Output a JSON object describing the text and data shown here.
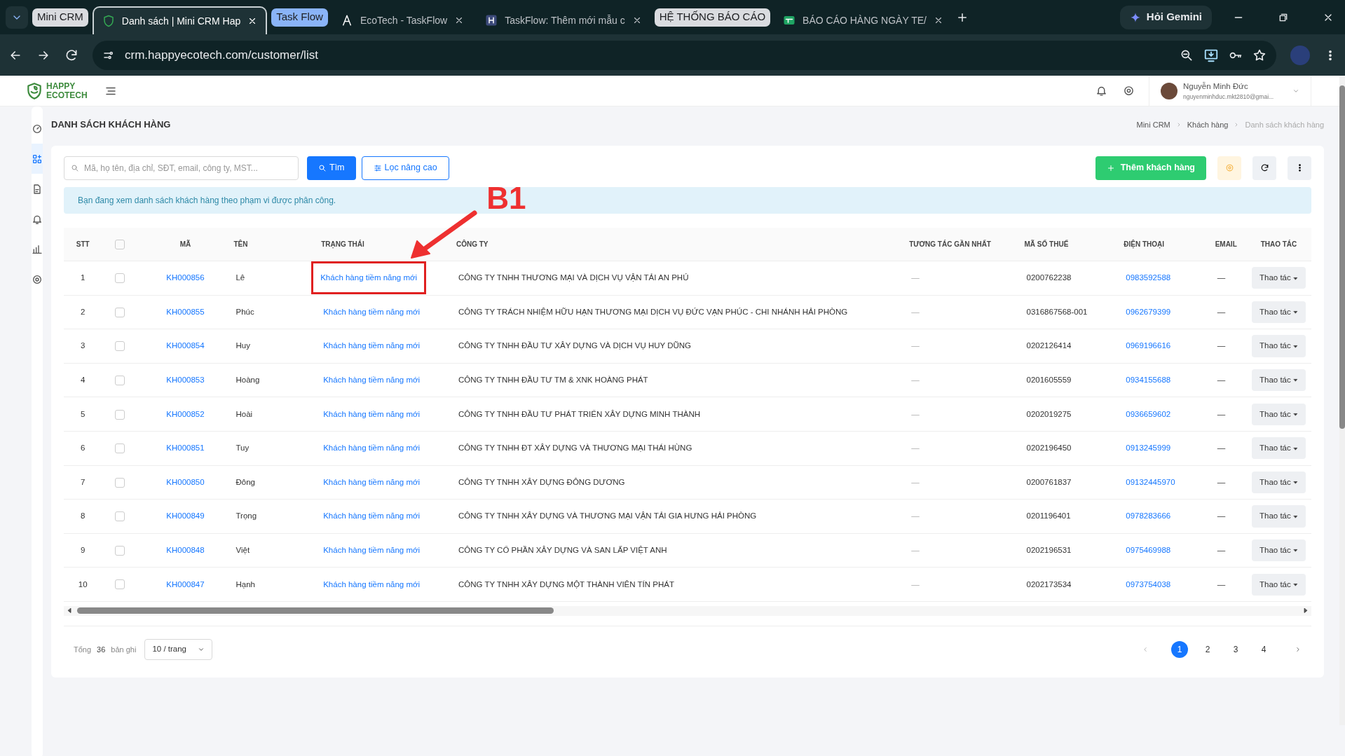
{
  "browser": {
    "tabs": [
      {
        "kind": "group",
        "label": "Mini CRM",
        "color": "#dadce0"
      },
      {
        "kind": "tab",
        "label": "Danh sách | Mini CRM Hap",
        "selected": true
      },
      {
        "kind": "group",
        "label": "Task Flow",
        "color": "#8ab4f8"
      },
      {
        "kind": "tab",
        "label": "EcoTech - TaskFlow",
        "selected": false
      },
      {
        "kind": "tab",
        "label": "TaskFlow: Thêm mới mẫu c",
        "selected": false
      },
      {
        "kind": "group",
        "label": "HỆ THỐNG BÁO CÁO",
        "color": "#dadce0"
      },
      {
        "kind": "tab",
        "label": "BÁO CÁO HÀNG NGÀY TE/",
        "selected": false
      }
    ],
    "gemini": "Hỏi Gemini",
    "url": "crm.happyecotech.com/customer/list"
  },
  "app_header": {
    "logo": [
      "HAPPY",
      "ECOTECH"
    ],
    "user": {
      "name": "Nguyễn Minh Đức",
      "email": "nguyenminhduc.mkt2810@gmai..."
    }
  },
  "sidebar": {
    "items": [
      {
        "kind": "dashboard",
        "selected": false
      },
      {
        "kind": "apps",
        "selected": true
      },
      {
        "kind": "document",
        "selected": false
      },
      {
        "kind": "bell",
        "selected": false
      },
      {
        "kind": "chart",
        "selected": false
      },
      {
        "kind": "gear",
        "selected": false
      }
    ]
  },
  "page": {
    "title": "DANH SÁCH KHÁCH HÀNG",
    "breadcrumb": [
      "Mini CRM",
      "Khách hàng",
      "Danh sách khách hàng"
    ]
  },
  "toolbar": {
    "search_placeholder": "Mã, họ tên, địa chỉ, SĐT, email, công ty, MST...",
    "search_button": "Tìm",
    "filter_button": "Lọc nâng cao",
    "add_button": "Thêm khách hàng"
  },
  "notice": "Bạn đang xem danh sách khách hàng theo phạm vi được phân công.",
  "table": {
    "select_all_checked": false,
    "columns": [
      "STT",
      "MÃ",
      "TÊN",
      "TRẠNG THÁI",
      "CÔNG TY",
      "TƯƠNG TÁC GẦN NHẤT",
      "MÃ SỐ THUẾ",
      "ĐIỆN THOẠI",
      "EMAIL",
      "THAO TÁC"
    ],
    "rows": [
      {
        "stt": "1",
        "checked": false,
        "code": "KH000856",
        "name": "Lê",
        "status": "Khách hàng tiềm năng mới",
        "highlighted": true,
        "company": "CÔNG TY TNHH THƯƠNG MẠI VÀ DỊCH VỤ VẬN TẢI AN PHÚ",
        "last_interaction": "—",
        "tax_code": "0200762238",
        "phone": "0983592588",
        "email": "—",
        "action": "Thao tác"
      },
      {
        "stt": "2",
        "checked": false,
        "code": "KH000855",
        "name": "Phúc",
        "status": "Khách hàng tiềm năng mới",
        "highlighted": false,
        "company": "CÔNG TY TRÁCH NHIỆM HỮU HẠN THƯƠNG MẠI DỊCH VỤ ĐỨC VẠN PHÚC - CHI NHÁNH HẢI PHÒNG",
        "last_interaction": "—",
        "tax_code": "0316867568-001",
        "phone": "0962679399",
        "email": "—",
        "action": "Thao tác"
      },
      {
        "stt": "3",
        "checked": false,
        "code": "KH000854",
        "name": "Huy",
        "status": "Khách hàng tiềm năng mới",
        "highlighted": false,
        "company": "CÔNG TY TNHH ĐẦU TƯ XÂY DỰNG VÀ DỊCH VỤ HUY DŨNG",
        "last_interaction": "—",
        "tax_code": "0202126414",
        "phone": "0969196616",
        "email": "—",
        "action": "Thao tác"
      },
      {
        "stt": "4",
        "checked": false,
        "code": "KH000853",
        "name": "Hoàng",
        "status": "Khách hàng tiềm năng mới",
        "highlighted": false,
        "company": "CÔNG TY TNHH ĐẦU TƯ TM & XNK HOÀNG PHÁT",
        "last_interaction": "—",
        "tax_code": "0201605559",
        "phone": "0934155688",
        "email": "—",
        "action": "Thao tác"
      },
      {
        "stt": "5",
        "checked": false,
        "code": "KH000852",
        "name": "Hoài",
        "status": "Khách hàng tiềm năng mới",
        "highlighted": false,
        "company": "CÔNG TY TNHH ĐẦU TƯ PHÁT TRIỂN XÂY DỰNG MINH THÀNH",
        "last_interaction": "—",
        "tax_code": "0202019275",
        "phone": "0936659602",
        "email": "—",
        "action": "Thao tác"
      },
      {
        "stt": "6",
        "checked": false,
        "code": "KH000851",
        "name": "Tuy",
        "status": "Khách hàng tiềm năng mới",
        "highlighted": false,
        "company": "CÔNG TY TNHH ĐT XÂY DỰNG VÀ THƯƠNG MẠI THÁI HÙNG",
        "last_interaction": "—",
        "tax_code": "0202196450",
        "phone": "0913245999",
        "email": "—",
        "action": "Thao tác"
      },
      {
        "stt": "7",
        "checked": false,
        "code": "KH000850",
        "name": "Đông",
        "status": "Khách hàng tiềm năng mới",
        "highlighted": false,
        "company": "CÔNG TY TNHH XÂY DỰNG ĐÔNG DƯƠNG",
        "last_interaction": "—",
        "tax_code": "0200761837",
        "phone": "09132445970",
        "email": "—",
        "action": "Thao tác"
      },
      {
        "stt": "8",
        "checked": false,
        "code": "KH000849",
        "name": "Trọng",
        "status": "Khách hàng tiềm năng mới",
        "highlighted": false,
        "company": "CÔNG TY TNHH XÂY DỰNG VÀ THƯƠNG MẠI VẬN TẢI GIA HƯNG HẢI PHÒNG",
        "last_interaction": "—",
        "tax_code": "0201196401",
        "phone": "0978283666",
        "email": "—",
        "action": "Thao tác"
      },
      {
        "stt": "9",
        "checked": false,
        "code": "KH000848",
        "name": "Việt",
        "status": "Khách hàng tiềm năng mới",
        "highlighted": false,
        "company": "CÔNG TY CỔ PHẦN XÂY DỰNG VÀ SAN LẤP VIỆT ANH",
        "last_interaction": "—",
        "tax_code": "0202196531",
        "phone": "0975469988",
        "email": "—",
        "action": "Thao tác"
      },
      {
        "stt": "10",
        "checked": false,
        "code": "KH000847",
        "name": "Hạnh",
        "status": "Khách hàng tiềm năng mới",
        "highlighted": false,
        "company": "CÔNG TY TNHH XÂY DỰNG MỘT THÀNH VIÊN TÍN PHÁT",
        "last_interaction": "—",
        "tax_code": "0202173534",
        "phone": "0973754038",
        "email": "—",
        "action": "Thao tác"
      }
    ]
  },
  "pagination": {
    "total_label": "Tổng",
    "total": "36",
    "unit": "bản ghi",
    "page_size": "10 / trang",
    "pages": [
      {
        "label": "1",
        "selected": true
      },
      {
        "label": "2",
        "selected": false
      },
      {
        "label": "3",
        "selected": false
      },
      {
        "label": "4",
        "selected": false
      }
    ]
  },
  "annotation": {
    "label": "B1"
  }
}
